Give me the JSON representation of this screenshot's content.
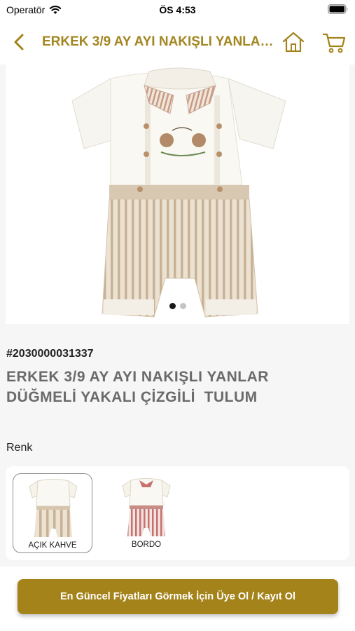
{
  "status_bar": {
    "carrier": "Operatör",
    "time": "ÖS 4:53"
  },
  "nav": {
    "title": "ERKEK 3/9 AY AYI NAKIŞLI YANLAR DÜĞMELİ YAKALI ÇİZGİLİ  TULUM",
    "icons": [
      "chevron-left-icon",
      "home-icon",
      "cart-icon"
    ]
  },
  "gallery": {
    "image_count": 2,
    "active_index": 0
  },
  "product": {
    "sku": "#2030000031337",
    "name": "ERKEK 3/9 AY AYI NAKIŞLI YANLAR DÜĞMELİ YAKALI ÇİZGİLİ  TULUM"
  },
  "color_section": {
    "label": "Renk",
    "variants": [
      {
        "label": "AÇIK KAHVE",
        "selected": true
      },
      {
        "label": "BORDO",
        "selected": false
      }
    ]
  },
  "cta": {
    "label": "En Güncel Fiyatları Görmek İçin Üye Ol / Kayıt Ol"
  },
  "colors": {
    "accent": "#a4831b",
    "title_gold": "#a38622",
    "background": "#f6f6f6"
  }
}
